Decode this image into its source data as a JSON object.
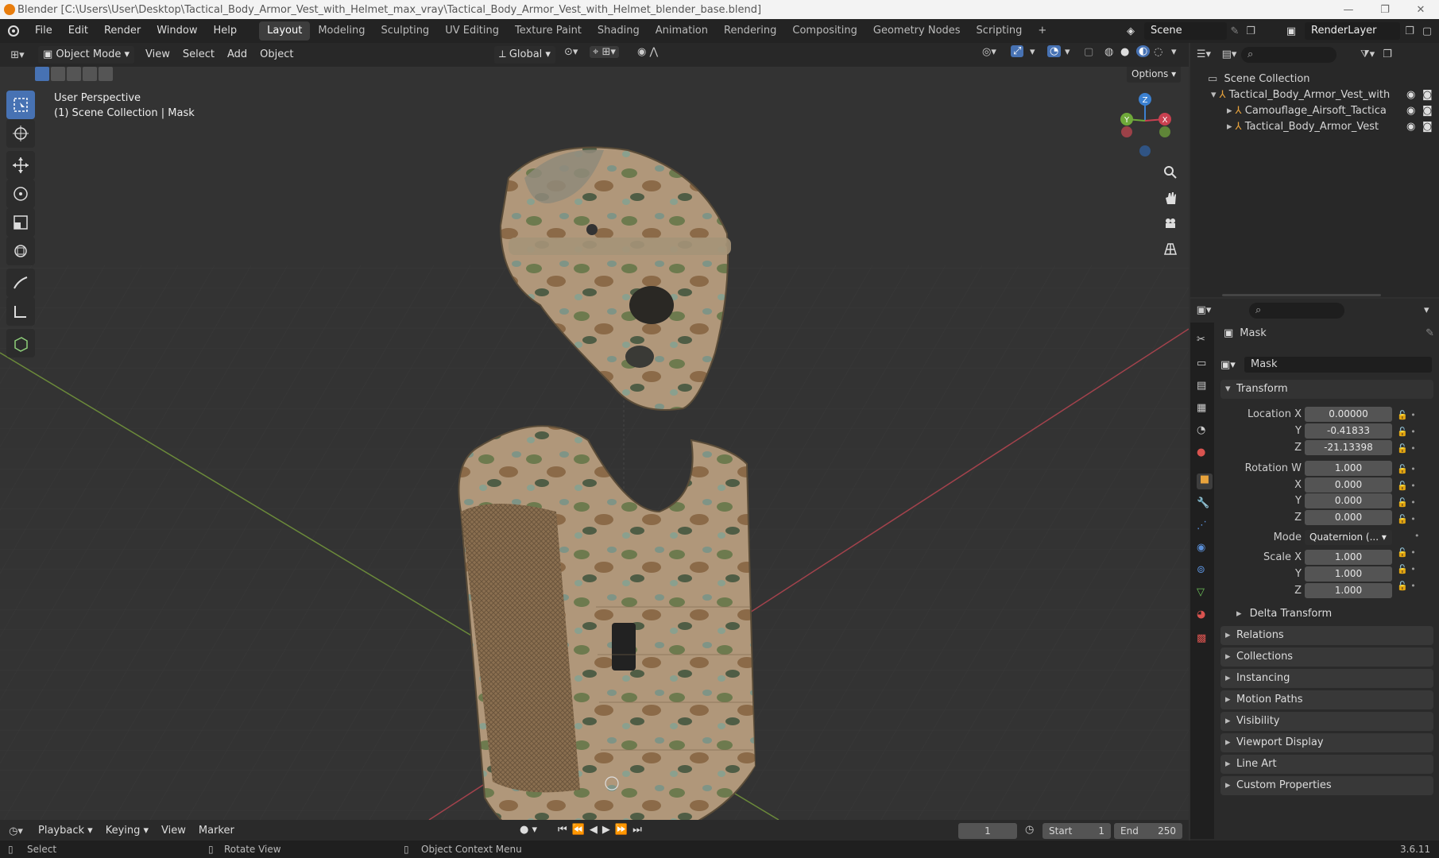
{
  "titlebar": {
    "title": "Blender [C:\\Users\\User\\Desktop\\Tactical_Body_Armor_Vest_with_Helmet_max_vray\\Tactical_Body_Armor_Vest_with_Helmet_blender_base.blend]",
    "minimize": "—",
    "maximize": "❐",
    "close": "✕"
  },
  "topbar": {
    "menus": [
      "File",
      "Edit",
      "Render",
      "Window",
      "Help"
    ],
    "workspaces": [
      "Layout",
      "Modeling",
      "Sculpting",
      "UV Editing",
      "Texture Paint",
      "Shading",
      "Animation",
      "Rendering",
      "Compositing",
      "Geometry Nodes",
      "Scripting"
    ],
    "add_workspace": "+",
    "scene": "Scene",
    "render_layer": "RenderLayer"
  },
  "viewport_header": {
    "mode": "Object Mode",
    "menus": [
      "View",
      "Select",
      "Add",
      "Object"
    ],
    "orientation": "Global",
    "options": "Options"
  },
  "viewport": {
    "perspective": "User Perspective",
    "collection_info": "(1) Scene Collection | Mask",
    "gizmo": {
      "z": "Z",
      "y": "Y",
      "x": "X"
    }
  },
  "outliner": {
    "root": "Scene Collection",
    "items": [
      {
        "label": "Tactical_Body_Armor_Vest_with",
        "level": 0,
        "expanded": true
      },
      {
        "label": "Camouflage_Airsoft_Tactica",
        "level": 1,
        "expanded": false
      },
      {
        "label": "Tactical_Body_Armor_Vest",
        "level": 1,
        "expanded": false
      }
    ]
  },
  "properties": {
    "object_name": "Mask",
    "object_field": "Mask",
    "transform_label": "Transform",
    "location_label": "Location X",
    "location": {
      "x": "0.00000",
      "y": "-0.41833",
      "z": "-21.13398"
    },
    "rotation_label": "Rotation W",
    "rotation": {
      "w": "1.000",
      "x": "0.000",
      "y": "0.000",
      "z": "0.000"
    },
    "mode_label": "Mode",
    "mode_value": "Quaternion (...",
    "scale_label": "Scale X",
    "scale": {
      "x": "1.000",
      "y": "1.000",
      "z": "1.000"
    },
    "axis": {
      "x": "X",
      "y": "Y",
      "z": "Z"
    },
    "delta": "Delta Transform",
    "panels": [
      "Relations",
      "Collections",
      "Instancing",
      "Motion Paths",
      "Visibility",
      "Viewport Display",
      "Line Art",
      "Custom Properties"
    ]
  },
  "timeline": {
    "menus": [
      "Playback",
      "Keying",
      "View",
      "Marker"
    ],
    "current_frame": "1",
    "start_label": "Start",
    "start": "1",
    "end_label": "End",
    "end": "250"
  },
  "statusbar": {
    "select": "Select",
    "rotate": "Rotate View",
    "context": "Object Context Menu",
    "version": "3.6.11"
  },
  "colors": {
    "accent": "#4772b3",
    "x_axis": "#c94050",
    "y_axis": "#6fa93a",
    "z_axis": "#3b80d0",
    "orange": "#e8a33c"
  }
}
